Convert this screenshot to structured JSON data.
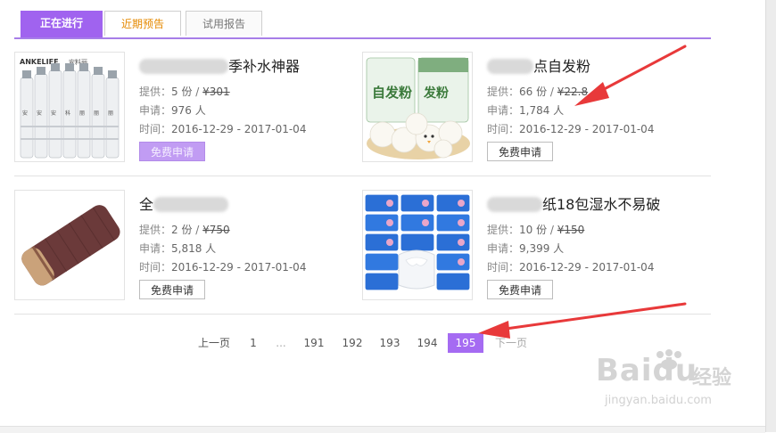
{
  "tabs": [
    "正在进行",
    "近期预告",
    "试用报告"
  ],
  "labels": {
    "provide": "提供：",
    "apply": "申请：",
    "time": "时间："
  },
  "products": [
    {
      "title_suffix": "季补水神器",
      "qty": "5 份",
      "price": "¥301",
      "applicants": "976 人",
      "time": "2016-12-29 - 2017-01-04",
      "button": "免费申请",
      "brand": "ANKELIFE",
      "bottle_label": "安料丽"
    },
    {
      "title_suffix": "点自发粉",
      "qty": "66 份",
      "price": "¥22.8",
      "applicants": "1,784 人",
      "time": "2016-12-29 - 2017-01-04",
      "button": "免费申请",
      "bag_text": "自发粉"
    },
    {
      "title_suffix": "全",
      "qty": "2 份",
      "price": "¥750",
      "applicants": "5,818 人",
      "time": "2016-12-29 - 2017-01-04",
      "button": "免费申请"
    },
    {
      "title_suffix": "纸18包湿水不易破",
      "qty": "10 份",
      "price": "¥150",
      "applicants": "9,399 人",
      "time": "2016-12-29 - 2017-01-04",
      "button": "免费申请"
    }
  ],
  "pagination": {
    "prev": "上一页",
    "pages": [
      "1",
      "...",
      "191",
      "192",
      "193",
      "194",
      "195"
    ],
    "current": "195",
    "next": "下一页"
  },
  "watermark": {
    "main": "Baidu",
    "cn": "经验",
    "url": "jingyan.baidu.com"
  },
  "colors": {
    "accent": "#a063ef",
    "current_page": "#a56bf2",
    "arrow": "#e8393a",
    "tab_orange": "#e58900"
  }
}
